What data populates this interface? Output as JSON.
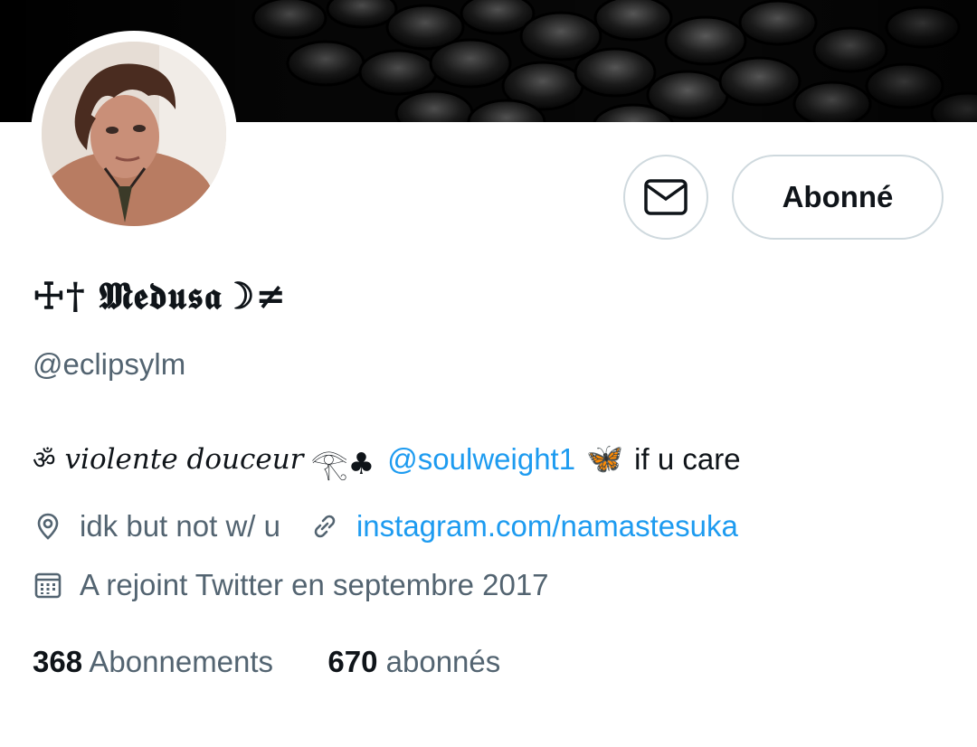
{
  "banner": {
    "image": "dark-scales-banner"
  },
  "profile": {
    "avatar": "profile-photo",
    "display_name": "☩† 𝕸𝖊𝖉𝖚𝖘𝖆☽≠",
    "handle": "@eclipsylm",
    "bio": {
      "om": "ॐ",
      "text1": "violente douceur",
      "glyphs": "𓂀♣",
      "mention": "@soulweight1",
      "emoji": "🦋",
      "text2": "if u care"
    },
    "location": "idk but not w/ u",
    "website": "instagram.com/namastesuka",
    "joined": "A rejoint Twitter en septembre 2017",
    "following_count": "368",
    "following_label": "Abonnements",
    "followers_count": "670",
    "followers_label": "abonnés"
  },
  "actions": {
    "message_icon": "envelope-icon",
    "follow_label": "Abonné"
  },
  "colors": {
    "link": "#1d9bf0",
    "secondary_text": "#536471",
    "border": "#cfd9de"
  }
}
